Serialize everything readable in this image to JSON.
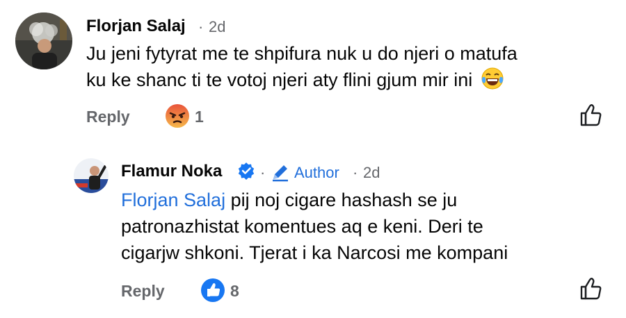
{
  "comments": [
    {
      "author": "Florjan Salaj",
      "separator": "·",
      "time": "2d",
      "lines": [
        "Ju jeni fytyrat me te shpifura nuk u do njeri o matufa",
        "ku ke shanc ti te votoj njeri aty flini gjum mir ini"
      ],
      "emoji": "laughing-tears-emoji",
      "reply_label": "Reply",
      "reaction": "angry-reaction-icon",
      "reaction_count": "1"
    },
    {
      "author": "Flamur Noka",
      "verified": "verified-badge-icon",
      "author_label": "Author",
      "separator": "·",
      "time": "2d",
      "mention": "Florjan Salaj",
      "line1_rest": " pij noj cigare hashash se ju",
      "line2": "patronazhistat komentues aq e keni. Deri te",
      "line3": "cigarjw shkoni. Tjerat i ka Narcosi me kompani",
      "reply_label": "Reply",
      "reaction": "like-reaction-icon",
      "reaction_count": "8"
    }
  ],
  "colors": {
    "link": "#216fdb",
    "meta": "#65676b",
    "verified": "#1877f2",
    "angry": "#f0563b",
    "like": "#1877f2"
  }
}
